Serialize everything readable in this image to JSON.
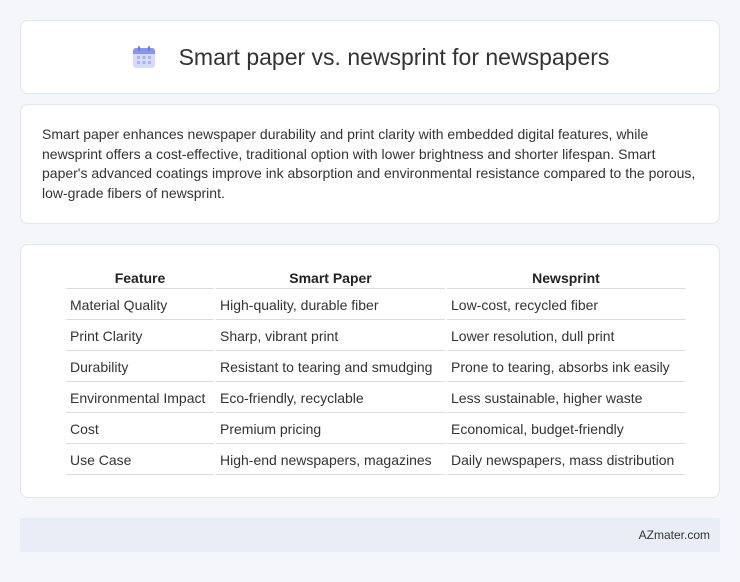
{
  "header": {
    "title": "Smart paper vs. newsprint for newspapers",
    "icon": "calendar-icon",
    "icon_colors": {
      "top": "#8a94e8",
      "body": "#d7dbf7",
      "dots": "#aab1ee"
    }
  },
  "summary": {
    "text": "Smart paper enhances newspaper durability and print clarity with embedded digital features, while newsprint offers a cost-effective, traditional option with lower brightness and shorter lifespan. Smart paper's advanced coatings improve ink absorption and environmental resistance compared to the porous, low-grade fibers of newsprint."
  },
  "table": {
    "headers": [
      "Feature",
      "Smart Paper",
      "Newsprint"
    ],
    "rows": [
      [
        "Material Quality",
        "High-quality, durable fiber",
        "Low-cost, recycled fiber"
      ],
      [
        "Print Clarity",
        "Sharp, vibrant print",
        "Lower resolution, dull print"
      ],
      [
        "Durability",
        "Resistant to tearing and smudging",
        "Prone to tearing, absorbs ink easily"
      ],
      [
        "Environmental Impact",
        "Eco-friendly, recyclable",
        "Less sustainable, higher waste"
      ],
      [
        "Cost",
        "Premium pricing",
        "Economical, budget-friendly"
      ],
      [
        "Use Case",
        "High-end newspapers, magazines",
        "Daily newspapers, mass distribution"
      ]
    ]
  },
  "footer": {
    "text": "AZmater.com"
  }
}
